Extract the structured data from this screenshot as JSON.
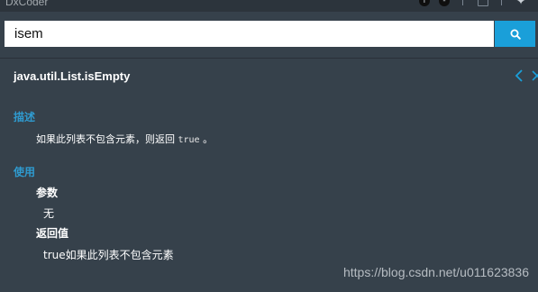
{
  "window": {
    "title": "DxCoder"
  },
  "search": {
    "value": "isem",
    "button_icon": "search-icon"
  },
  "doc": {
    "title": "java.util.List.isEmpty",
    "nav_prev_icon": "chevron-left-icon",
    "nav_close_icon": "close-icon",
    "description_heading": "描述",
    "description_text_before": "如果此列表不包含元素，则返回 ",
    "description_code": "true",
    "description_text_after": " 。",
    "usage_heading": "使用",
    "params_heading": "参数",
    "params_value": "无",
    "returns_heading": "返回值",
    "returns_value": "true如果此列表不包含元素"
  },
  "watermark": "https://blog.csdn.net/u011623836",
  "colors": {
    "background": "#36414b",
    "accent": "#1a9fd9",
    "heading": "#2f9bd0"
  }
}
